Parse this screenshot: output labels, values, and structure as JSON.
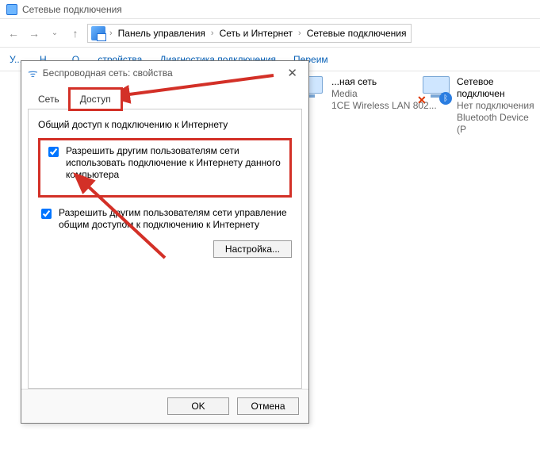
{
  "window": {
    "title": "Сетевые подключения"
  },
  "breadcrumbs": {
    "control_panel": "Панель управления",
    "net_internet": "Сеть и Интернет",
    "net_connections": "Сетевые подключения"
  },
  "toolbar": {
    "item0": "У...",
    "item1": "Н...",
    "item2": "О...   ...стройства",
    "diag": "Диагностика подключения",
    "rename": "Переим"
  },
  "adapters": {
    "wifi": {
      "line1": "...ная сеть",
      "line2": "Media",
      "line3": "1CE Wireless LAN 802..."
    },
    "bt": {
      "line1": "Сетевое подключен",
      "line2": "Нет подключения",
      "line3": "Bluetooth Device (P"
    }
  },
  "dialog": {
    "title": "Беспроводная сеть: свойства",
    "tab_net": "Сеть",
    "tab_share": "Доступ",
    "group_head": "Общий доступ к подключению к Интернету",
    "chk1": "Разрешить другим пользователям сети использовать подключение к Интернету данного компьютера",
    "chk2": "Разрешить другим пользователям сети управление общим доступом к подключению к Интернету",
    "configure": "Настройка...",
    "ok": "OK",
    "cancel": "Отмена"
  }
}
